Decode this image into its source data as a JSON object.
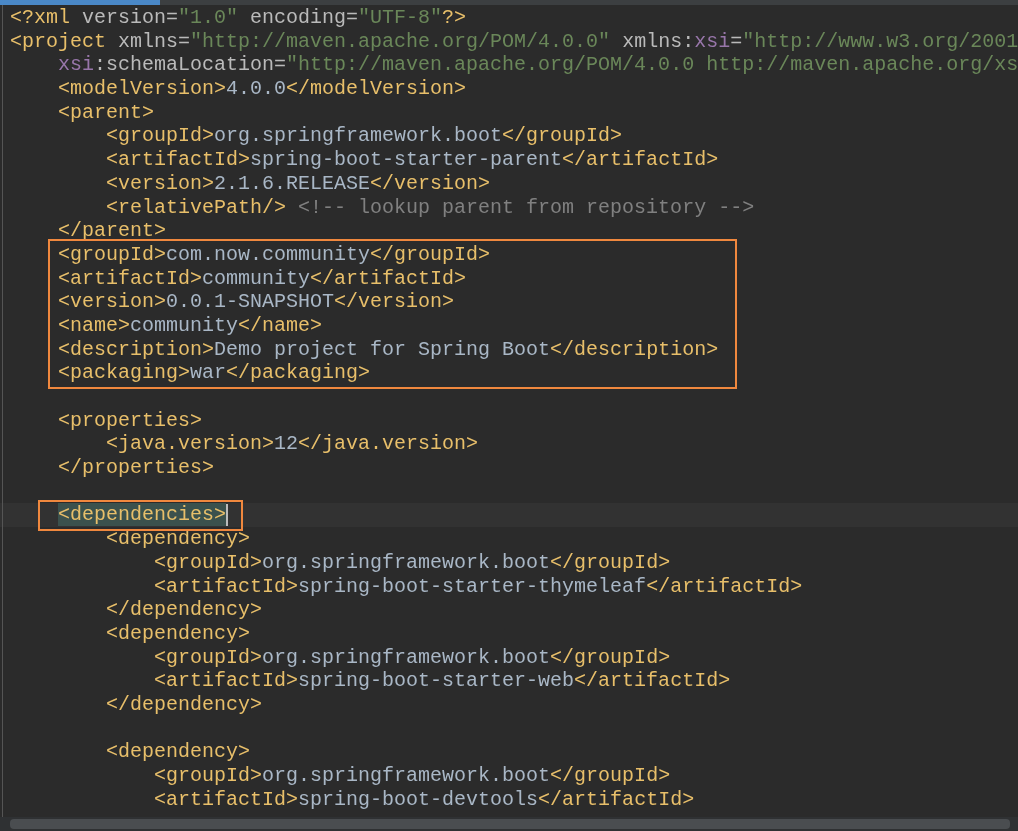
{
  "editor": {
    "lines": [
      {
        "tokens": [
          {
            "kind": "tag",
            "text": "<?xml "
          },
          {
            "kind": "attr",
            "text": "version="
          },
          {
            "kind": "value",
            "text": "\"1.0\""
          },
          {
            "kind": "attr",
            "text": " encoding="
          },
          {
            "kind": "value",
            "text": "\"UTF-8\""
          },
          {
            "kind": "tag",
            "text": "?>"
          }
        ]
      },
      {
        "tokens": [
          {
            "kind": "tag",
            "text": "<project "
          },
          {
            "kind": "attr",
            "text": "xmlns="
          },
          {
            "kind": "value",
            "text": "\"http://maven.apache.org/POM/4.0.0\""
          },
          {
            "kind": "attr",
            "text": " xmlns:"
          },
          {
            "kind": "ns",
            "text": "xsi"
          },
          {
            "kind": "attr",
            "text": "="
          },
          {
            "kind": "value",
            "text": "\"http://www.w3.org/2001"
          }
        ]
      },
      {
        "tokens": [
          {
            "kind": "ns",
            "text": "    xsi"
          },
          {
            "kind": "attr",
            "text": ":schemaLocation="
          },
          {
            "kind": "value",
            "text": "\"http://maven.apache.org/POM/4.0.0 http://maven.apache.org/xs"
          }
        ]
      },
      {
        "tokens": [
          {
            "kind": "tag",
            "text": "    <modelVersion>"
          },
          {
            "kind": "text",
            "text": "4.0.0"
          },
          {
            "kind": "tag",
            "text": "</modelVersion>"
          }
        ]
      },
      {
        "tokens": [
          {
            "kind": "tag",
            "text": "    <parent>"
          }
        ]
      },
      {
        "tokens": [
          {
            "kind": "tag",
            "text": "        <groupId>"
          },
          {
            "kind": "text",
            "text": "org.springframework.boot"
          },
          {
            "kind": "tag",
            "text": "</groupId>"
          }
        ]
      },
      {
        "tokens": [
          {
            "kind": "tag",
            "text": "        <artifactId>"
          },
          {
            "kind": "text",
            "text": "spring-boot-starter-parent"
          },
          {
            "kind": "tag",
            "text": "</artifactId>"
          }
        ]
      },
      {
        "tokens": [
          {
            "kind": "tag",
            "text": "        <version>"
          },
          {
            "kind": "text",
            "text": "2.1.6.RELEASE"
          },
          {
            "kind": "tag",
            "text": "</version>"
          }
        ]
      },
      {
        "tokens": [
          {
            "kind": "tag",
            "text": "        <relativePath/>"
          },
          {
            "kind": "comment",
            "text": " <!-- lookup parent from repository -->"
          }
        ]
      },
      {
        "tokens": [
          {
            "kind": "tag",
            "text": "    </parent>"
          }
        ]
      },
      {
        "boxed": true,
        "tokens": [
          {
            "kind": "tag",
            "text": "    <groupId>"
          },
          {
            "kind": "text",
            "text": "com.now.community"
          },
          {
            "kind": "tag",
            "text": "</groupId>"
          }
        ]
      },
      {
        "boxed": true,
        "tokens": [
          {
            "kind": "tag",
            "text": "    <artifactId>"
          },
          {
            "kind": "text",
            "text": "community"
          },
          {
            "kind": "tag",
            "text": "</artifactId>"
          }
        ]
      },
      {
        "boxed": true,
        "tokens": [
          {
            "kind": "tag",
            "text": "    <version>"
          },
          {
            "kind": "text",
            "text": "0.0.1-SNAPSHOT"
          },
          {
            "kind": "tag",
            "text": "</version>"
          }
        ]
      },
      {
        "boxed": true,
        "tokens": [
          {
            "kind": "tag",
            "text": "    <name>"
          },
          {
            "kind": "text",
            "text": "community"
          },
          {
            "kind": "tag",
            "text": "</name>"
          }
        ]
      },
      {
        "boxed": true,
        "tokens": [
          {
            "kind": "tag",
            "text": "    <description>"
          },
          {
            "kind": "text",
            "text": "Demo project for Spring Boot"
          },
          {
            "kind": "tag",
            "text": "</description>"
          }
        ]
      },
      {
        "boxed": true,
        "tokens": [
          {
            "kind": "tag",
            "text": "    <packaging>"
          },
          {
            "kind": "text",
            "text": "war"
          },
          {
            "kind": "tag",
            "text": "</packaging>"
          }
        ]
      },
      {
        "space_before": true,
        "tokens": [
          {
            "kind": "tag",
            "text": "    <properties>"
          }
        ]
      },
      {
        "tokens": [
          {
            "kind": "tag",
            "text": "        <java.version>"
          },
          {
            "kind": "text",
            "text": "12"
          },
          {
            "kind": "tag",
            "text": "</java.version>"
          }
        ]
      },
      {
        "tokens": [
          {
            "kind": "tag",
            "text": "    </properties>"
          }
        ]
      },
      {
        "space_before": true,
        "boxed": true,
        "current": true,
        "tokens": [
          {
            "kind": "tag",
            "text": "    <dependencies>",
            "matched": true
          }
        ]
      },
      {
        "tokens": [
          {
            "kind": "tag",
            "text": "        <dependency>"
          }
        ]
      },
      {
        "tokens": [
          {
            "kind": "tag",
            "text": "            <groupId>"
          },
          {
            "kind": "text",
            "text": "org.springframework.boot"
          },
          {
            "kind": "tag",
            "text": "</groupId>"
          }
        ]
      },
      {
        "tokens": [
          {
            "kind": "tag",
            "text": "            <artifactId>"
          },
          {
            "kind": "text",
            "text": "spring-boot-starter-thymeleaf"
          },
          {
            "kind": "tag",
            "text": "</artifactId>"
          }
        ]
      },
      {
        "tokens": [
          {
            "kind": "tag",
            "text": "        </dependency>"
          }
        ]
      },
      {
        "tokens": [
          {
            "kind": "tag",
            "text": "        <dependency>"
          }
        ]
      },
      {
        "tokens": [
          {
            "kind": "tag",
            "text": "            <groupId>"
          },
          {
            "kind": "text",
            "text": "org.springframework.boot"
          },
          {
            "kind": "tag",
            "text": "</groupId>"
          }
        ]
      },
      {
        "tokens": [
          {
            "kind": "tag",
            "text": "            <artifactId>"
          },
          {
            "kind": "text",
            "text": "spring-boot-starter-web"
          },
          {
            "kind": "tag",
            "text": "</artifactId>"
          }
        ]
      },
      {
        "tokens": [
          {
            "kind": "tag",
            "text": "        </dependency>"
          }
        ]
      },
      {
        "space_before": true,
        "tokens": [
          {
            "kind": "tag",
            "text": "        <dependency>"
          }
        ]
      },
      {
        "tokens": [
          {
            "kind": "tag",
            "text": "            <groupId>"
          },
          {
            "kind": "text",
            "text": "org.springframework.boot"
          },
          {
            "kind": "tag",
            "text": "</groupId>"
          }
        ]
      },
      {
        "tokens": [
          {
            "kind": "tag",
            "text": "            <artifactId>"
          },
          {
            "kind": "text",
            "text": "spring-boot-devtools"
          },
          {
            "kind": "tag",
            "text": "</artifactId>"
          }
        ]
      }
    ]
  }
}
